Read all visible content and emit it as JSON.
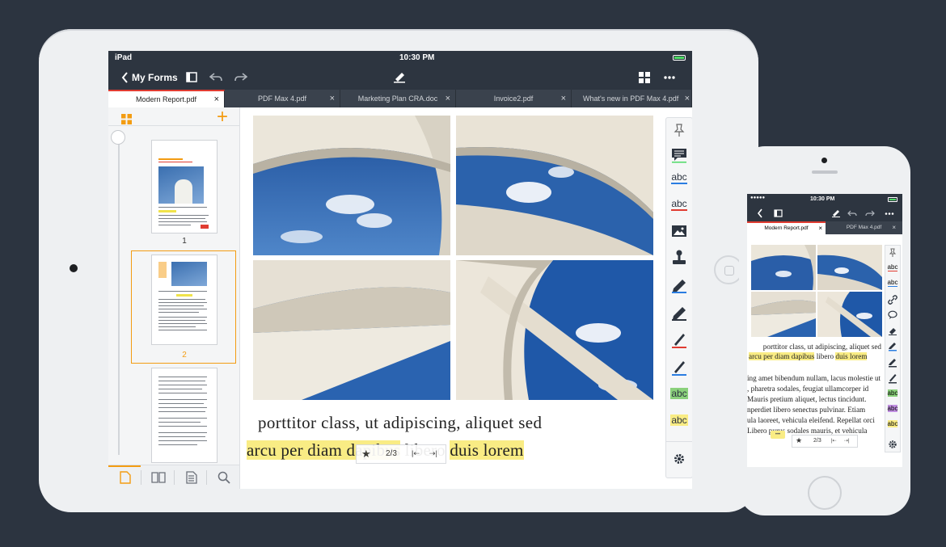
{
  "ipad": {
    "status": {
      "carrier": "iPad",
      "time": "10:30 PM"
    },
    "toolbar": {
      "back_label": "My Forms"
    },
    "tabs": [
      {
        "label": "Modern Report.pdf",
        "active": true
      },
      {
        "label": "PDF Max 4.pdf",
        "active": false
      },
      {
        "label": "Marketing Plan CRA.doc",
        "active": false
      },
      {
        "label": "Invoice2.pdf",
        "active": false
      },
      {
        "label": "What's new in PDF Max 4.pdf",
        "active": false
      }
    ],
    "close_glyph": "×",
    "sidebar": {
      "add_glyph": "+",
      "pages": [
        {
          "number": "1",
          "selected": false
        },
        {
          "number": "2",
          "selected": true
        }
      ]
    },
    "document": {
      "line1": "porttitor class, ut adipiscing, aliquet sed",
      "line2_parts": [
        {
          "text": "arcu per diam dapibus",
          "highlight": true
        },
        {
          "text": " libero ",
          "highlight": false
        },
        {
          "text": "duis lorem",
          "highlight": true
        }
      ]
    },
    "pager": {
      "star": "★",
      "page": "2/3",
      "prev": "|⇠",
      "next": "⇢|"
    },
    "tools": [
      {
        "name": "pin-icon"
      },
      {
        "name": "comment-icon"
      },
      {
        "name": "text-underline-icon",
        "label": "abc",
        "color": "#2a7de1"
      },
      {
        "name": "text-strikethrough-icon",
        "label": "abc",
        "color": "#e03c31"
      },
      {
        "name": "image-icon"
      },
      {
        "name": "stamp-icon"
      },
      {
        "name": "highlighter-blue-icon"
      },
      {
        "name": "highlighter-dark-icon"
      },
      {
        "name": "pen-red-icon"
      },
      {
        "name": "pen-blue-icon"
      },
      {
        "name": "text-highlight-green-icon",
        "label": "abc",
        "color": "#8bd17c"
      },
      {
        "name": "text-highlight-yellow-icon",
        "label": "abc",
        "color": "#f9ec84"
      }
    ]
  },
  "iphone": {
    "status": {
      "signal": "●●●●●",
      "time": "10:30 PM"
    },
    "tabs": [
      {
        "label": "Modern Report.pdf",
        "active": true
      },
      {
        "label": "PDF Max 4.pdf",
        "active": false
      }
    ],
    "close_glyph": "×",
    "text_lines": [
      [
        {
          "text": "porttitor class, ut adipiscing, aliquet sed",
          "highlight": false
        }
      ],
      [
        {
          "text": "arcu per diam dapibus",
          "highlight": true
        },
        {
          "text": " libero ",
          "highlight": false
        },
        {
          "text": "duis lorem",
          "highlight": true
        }
      ],
      [
        {
          "text": "",
          "highlight": false
        }
      ],
      [
        {
          "text": "ing amet bibendum nullam, lacus molestie ut",
          "highlight": false
        }
      ],
      [
        {
          "text": ", pharetra sodales, feugiat ullamcorper id",
          "highlight": false
        }
      ],
      [
        {
          "text": "Mauris pretium aliquet, lectus tincidunt.",
          "highlight": false
        }
      ],
      [
        {
          "text": "nperdiet libero senectus pulvinar. Etiam",
          "highlight": false
        }
      ],
      [
        {
          "text": "ula laoreet, vehicula eleifend. Repellat orci",
          "highlight": false
        }
      ],
      [
        {
          "text": "Libero purus sodales mauris, et vehicula",
          "highlight": false
        }
      ]
    ],
    "note_glyph": "•••",
    "pager": {
      "star": "★",
      "page": "2/3",
      "prev": "|⇠",
      "next": "⇢|"
    },
    "tools": [
      {
        "name": "pin-icon"
      },
      {
        "name": "text-strikethrough-icon",
        "label": "abc",
        "color": "#e03c31"
      },
      {
        "name": "text-underline-icon",
        "label": "abc",
        "color": "#2a7de1"
      },
      {
        "name": "link-icon"
      },
      {
        "name": "speech-bubble-icon"
      },
      {
        "name": "eraser-icon"
      },
      {
        "name": "highlighter-blue-icon"
      },
      {
        "name": "highlighter-dark-icon"
      },
      {
        "name": "pen-dark-icon"
      },
      {
        "name": "text-highlight-green-icon",
        "label": "abc",
        "color": "#8bd17c"
      },
      {
        "name": "text-highlight-purple-icon",
        "label": "abc",
        "color": "#c08ee0"
      },
      {
        "name": "text-highlight-yellow-icon",
        "label": "abc",
        "color": "#f9ec84"
      }
    ]
  },
  "colors": {
    "accent": "#f39c12",
    "active_tab": "#e03c31",
    "toolbar": "#2d3540",
    "background": "#2c3440"
  }
}
